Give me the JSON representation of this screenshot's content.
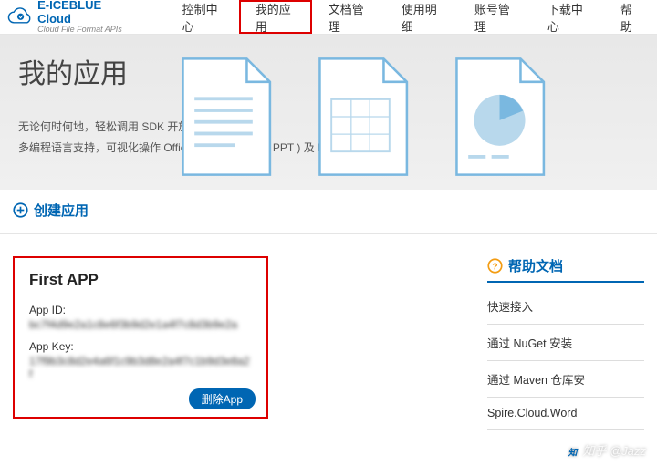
{
  "header": {
    "logo": {
      "title": "E-ICEBLUE Cloud",
      "subtitle": "Cloud File Format APIs"
    },
    "nav": [
      {
        "label": "控制中心"
      },
      {
        "label": "我的应用"
      },
      {
        "label": "文档管理"
      },
      {
        "label": "使用明细"
      },
      {
        "label": "账号管理"
      },
      {
        "label": "下载中心"
      },
      {
        "label": "帮助"
      }
    ]
  },
  "banner": {
    "title": "我的应用",
    "line1": "无论何时何地，轻松调用 SDK 开放接口",
    "line2": "多编程语言支持，可视化操作 Office ( Word / Excel / PPT ) 及 PDF 文档"
  },
  "action": {
    "create_label": "创建应用"
  },
  "app_card": {
    "name_value": "First APP",
    "id_label": "App ID:",
    "id_value": "bc7f4d9e2a1c8e6f3b9d2e1a4f7c8d3b9e2a",
    "key_label": "App Key:",
    "key_value": "17f9b3c8d2e4a6f1c9b3d8e2a4f7c1b9d3e8a2f",
    "delete_label": "删除App"
  },
  "help": {
    "title": "帮助文档",
    "items": [
      {
        "label": "快速接入"
      },
      {
        "label": "通过 NuGet 安装 "
      },
      {
        "label": "通过 Maven 仓库安"
      },
      {
        "label": "Spire.Cloud.Word"
      }
    ]
  },
  "watermark": {
    "text": "知乎 @Jazz"
  }
}
